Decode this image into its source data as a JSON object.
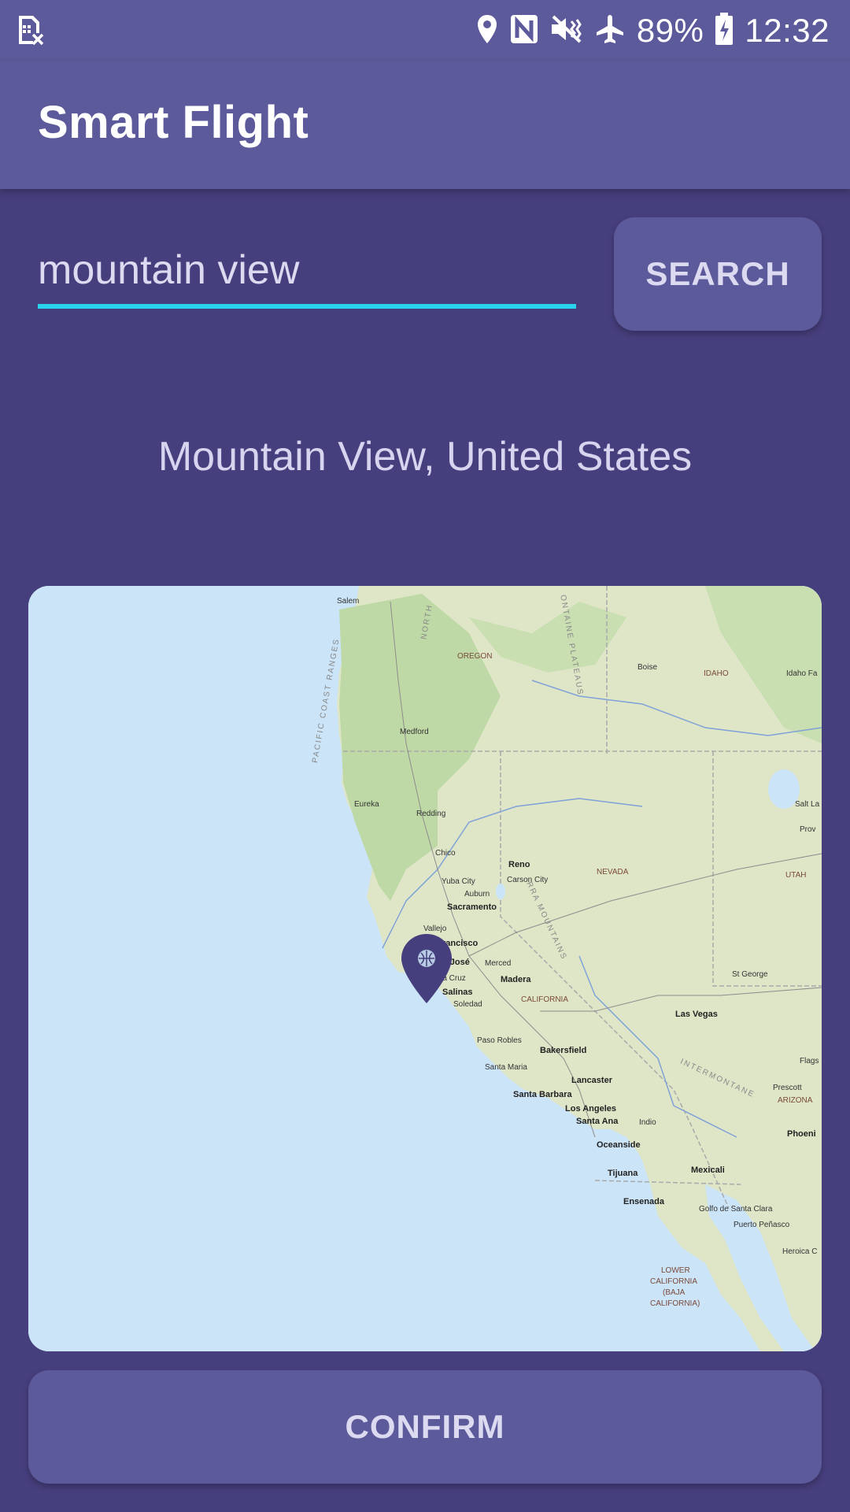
{
  "status_bar": {
    "battery": "89%",
    "time": "12:32",
    "icons": [
      "sim-error-icon",
      "location-icon",
      "nfc-icon",
      "mute-vibrate-icon",
      "airplane-icon",
      "battery-charging-icon"
    ]
  },
  "app_bar": {
    "title": "Smart Flight"
  },
  "search": {
    "value": "mountain view",
    "button_label": "SEARCH"
  },
  "location": {
    "label": "Mountain View, United States"
  },
  "map": {
    "marker_icon": "map-pin-icon",
    "labels": {
      "salem": "Salem",
      "oregon": "OREGON",
      "boise": "Boise",
      "idaho": "IDAHO",
      "idaho_falls": "Idaho Fa",
      "medford": "Medford",
      "pacific_coast_ranges": "PACIFIC COAST RANGES",
      "north": "NORTH",
      "montaine_plateaus": "ONTAINE PLATEAUS",
      "eureka": "Eureka",
      "redding": "Redding",
      "salt_lake": "Salt La",
      "provo": "Prov",
      "chico": "Chico",
      "reno": "Reno",
      "carson_city": "Carson City",
      "nevada": "NEVADA",
      "utah": "UTAH",
      "yuba_city": "Yuba City",
      "auburn": "Auburn",
      "sacramento": "Sacramento",
      "vallejo": "Vallejo",
      "san_francisco": "rancisco",
      "san_jose": "n José",
      "merced": "Merced",
      "sierra_mountains": "RRA MOUNTAINS",
      "santa_cruz": "nta Cruz",
      "madera": "Madera",
      "salinas": "Salinas",
      "soledad": "Soledad",
      "california": "CALIFORNIA",
      "st_george": "St George",
      "las_vegas": "Las Vegas",
      "paso_robles": "Paso Robles",
      "bakersfield": "Bakersfield",
      "santa_maria": "Santa Maria",
      "flagstaff": "Flags",
      "lancaster": "Lancaster",
      "intermontane": "INTERMONTANE",
      "santa_barbara": "Santa Barbara",
      "prescott": "Prescott",
      "arizona": "ARIZONA",
      "los_angeles": "Los Angeles",
      "santa_ana": "Santa Ana",
      "indio": "Indio",
      "phoenix": "Phoeni",
      "oceanside": "Oceanside",
      "tijuana": "Tijuana",
      "mexicali": "Mexicali",
      "ensenada": "Ensenada",
      "golfo": "Golfo de Santa Clara",
      "puerto_penasco": "Puerto Peñasco",
      "heroica": "Heroica C",
      "lower_california": "LOWER",
      "lower_california_2": "CALIFORNIA",
      "baja": "(BAJA",
      "baja_2": "CALIFORNIA)"
    }
  },
  "confirm": {
    "label": "CONFIRM"
  }
}
